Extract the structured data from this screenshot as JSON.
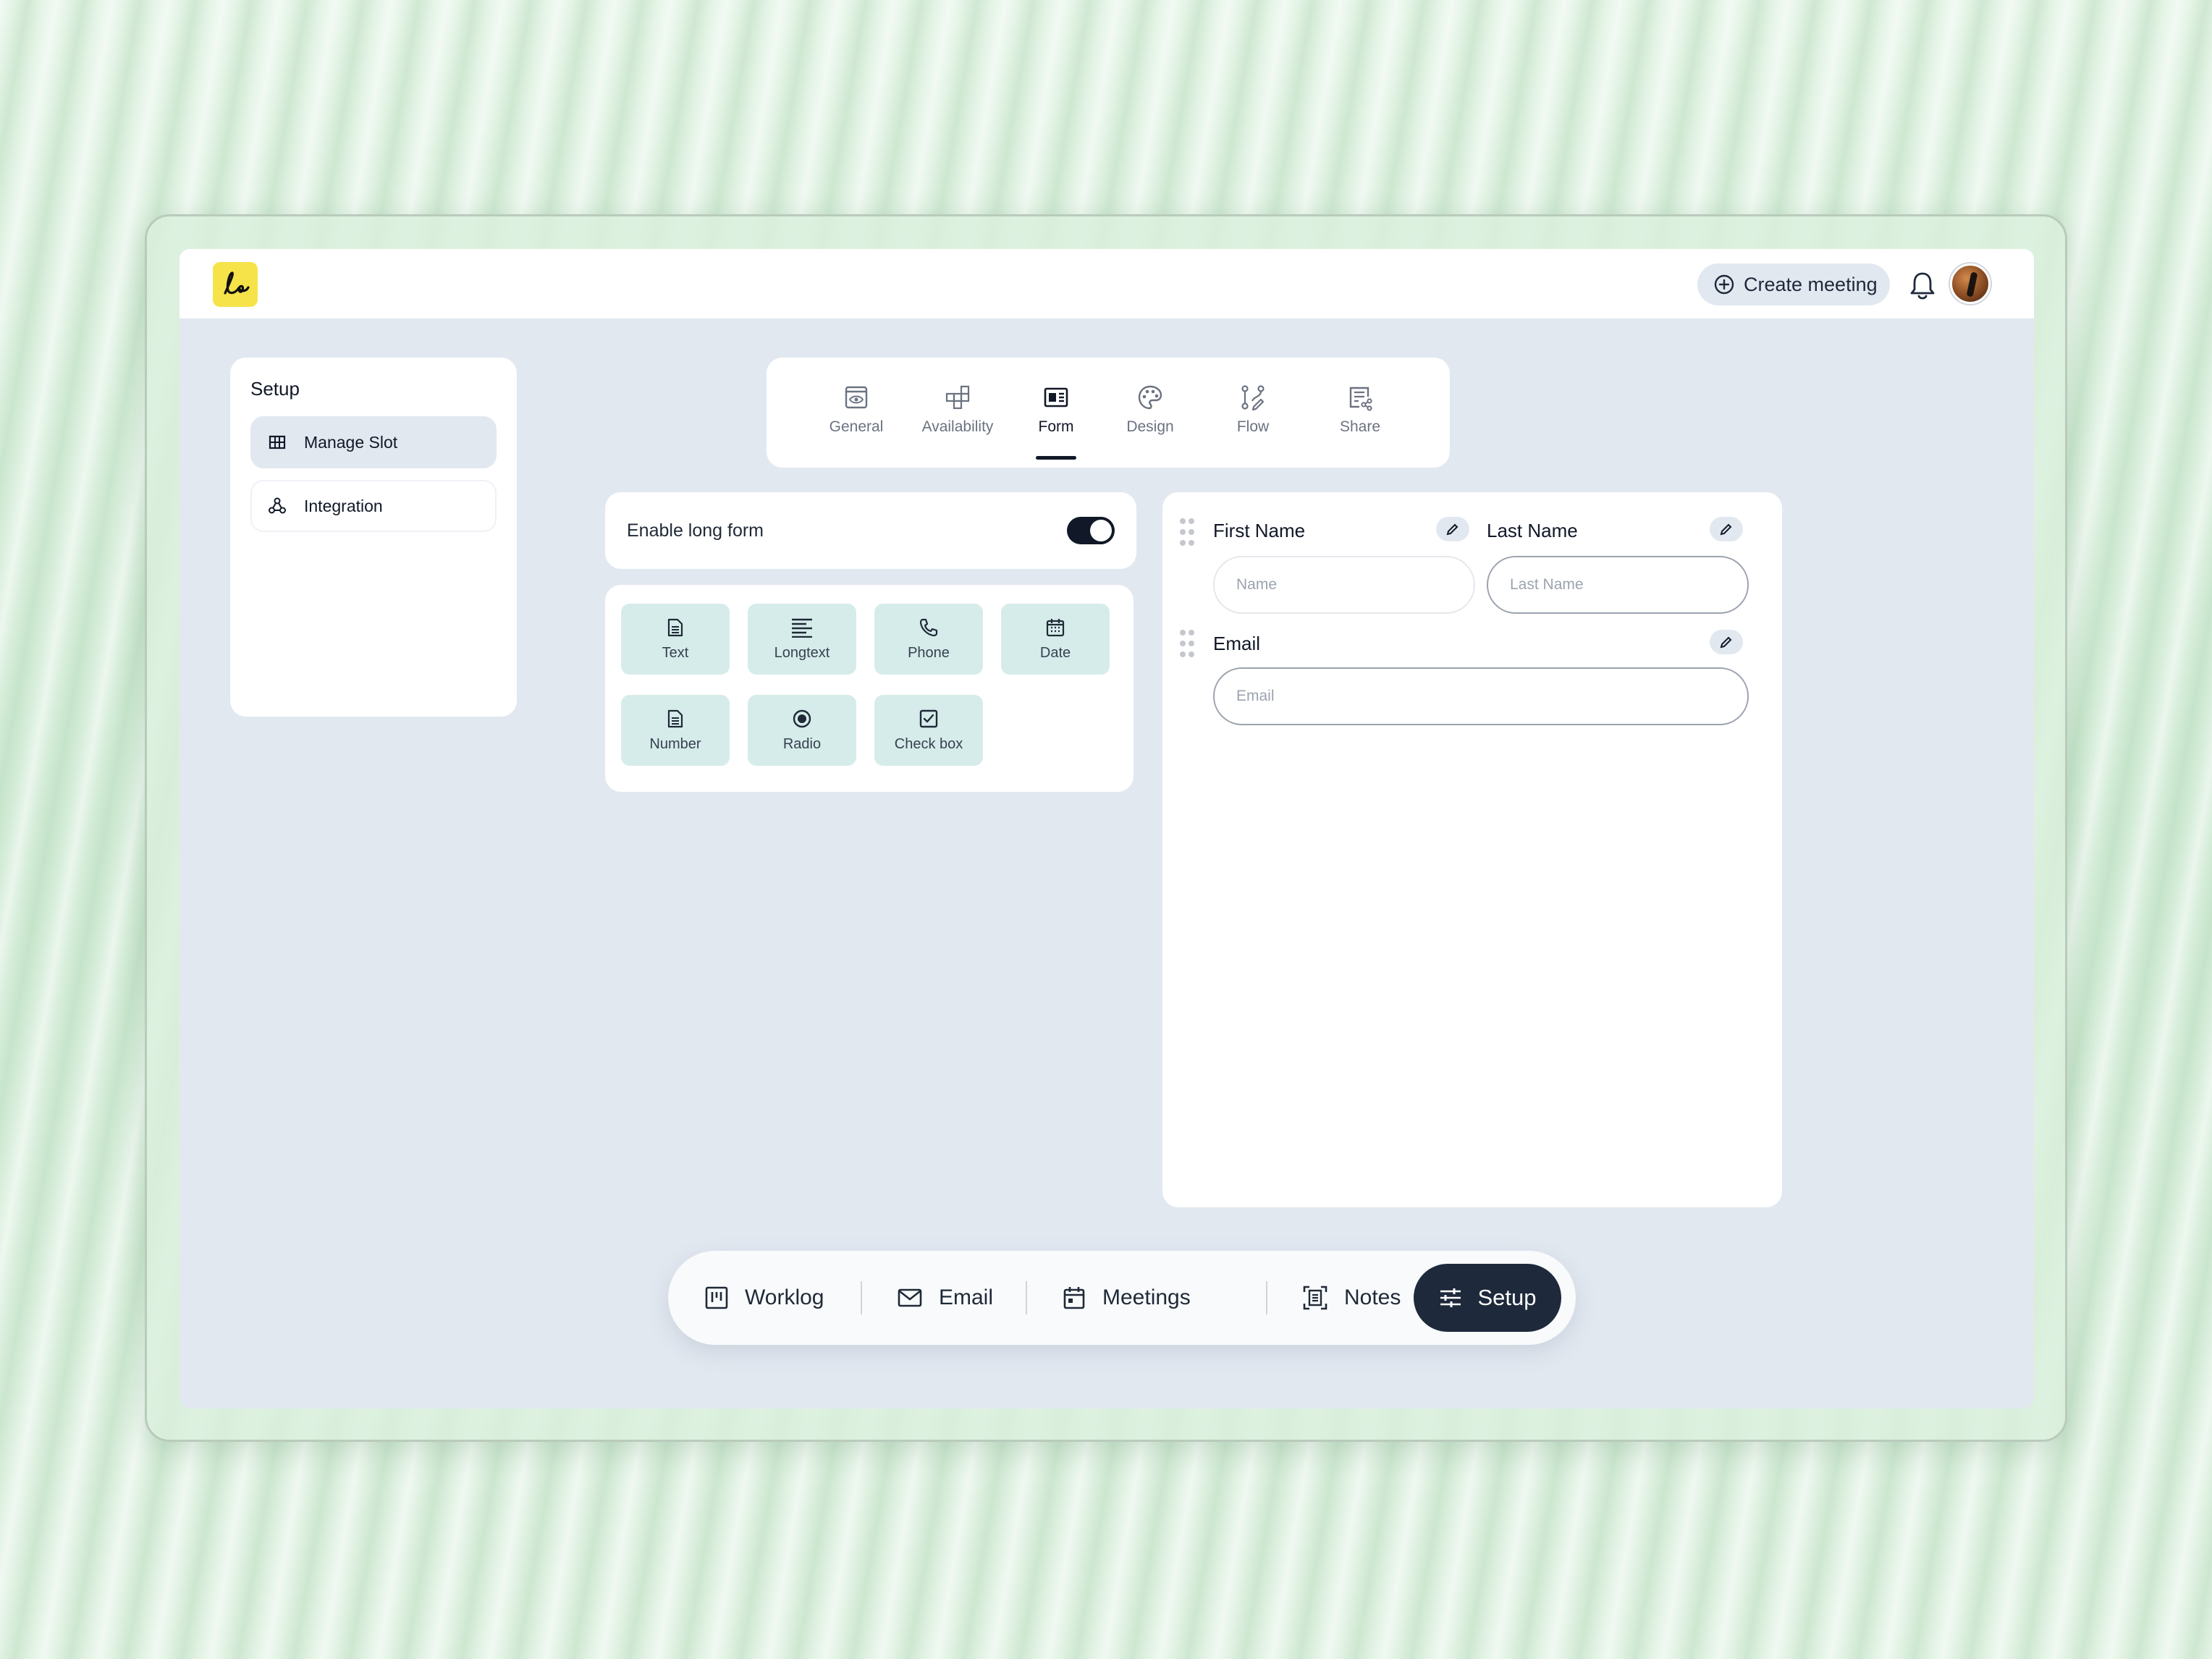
{
  "header": {
    "create_meeting": "Create meeting"
  },
  "sidebar": {
    "title": "Setup",
    "items": [
      {
        "label": "Manage Slot",
        "icon": "grid-icon",
        "active": true
      },
      {
        "label": "Integration",
        "icon": "integration-icon",
        "active": false
      }
    ]
  },
  "tabs": [
    {
      "label": "General",
      "icon": "eye-window-icon"
    },
    {
      "label": "Availability",
      "icon": "blocks-icon"
    },
    {
      "label": "Form",
      "icon": "form-icon",
      "active": true
    },
    {
      "label": "Design",
      "icon": "palette-icon"
    },
    {
      "label": "Flow",
      "icon": "flow-icon"
    },
    {
      "label": "Share",
      "icon": "share-icon"
    }
  ],
  "long_form": {
    "label": "Enable long form",
    "enabled": true
  },
  "field_types": [
    {
      "label": "Text",
      "icon": "document-icon"
    },
    {
      "label": "Longtext",
      "icon": "align-left-icon"
    },
    {
      "label": "Phone",
      "icon": "phone-icon"
    },
    {
      "label": "Date",
      "icon": "calendar-icon"
    },
    {
      "label": "Number",
      "icon": "document-icon"
    },
    {
      "label": "Radio",
      "icon": "radio-icon"
    },
    {
      "label": "Check box",
      "icon": "checkbox-icon"
    }
  ],
  "form_preview": {
    "first_name": {
      "label": "First Name",
      "placeholder": "Name"
    },
    "last_name": {
      "label": "Last Name",
      "placeholder": "Last Name"
    },
    "email": {
      "label": "Email",
      "placeholder": "Email"
    }
  },
  "bottom_nav": [
    {
      "label": "Worklog",
      "icon": "board-icon"
    },
    {
      "label": "Email",
      "icon": "mail-icon"
    },
    {
      "label": "Meetings",
      "icon": "calendar-icon"
    },
    {
      "label": "Notes",
      "icon": "scan-icon"
    },
    {
      "label": "Setup",
      "icon": "sliders-icon",
      "active": true
    }
  ],
  "colors": {
    "logo_bg": "#f6e34a",
    "tile_bg": "#d6ecea",
    "dark": "#1e293b",
    "screen_bg": "#e2e8f0"
  }
}
